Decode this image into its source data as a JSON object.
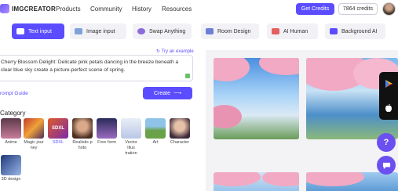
{
  "header": {
    "brand": "IMGCREATOR",
    "nav": [
      "Products",
      "Community",
      "History",
      "Resources"
    ],
    "get_credits": "Get Credits",
    "credits": "7864 credits"
  },
  "tabs": [
    {
      "label": "Text input",
      "active": true
    },
    {
      "label": "Image input"
    },
    {
      "label": "Swap Anything"
    },
    {
      "label": "Room Design"
    },
    {
      "label": "AI Human"
    },
    {
      "label": "Background AI"
    }
  ],
  "prompt": {
    "try_example": "Try an example",
    "text": "Cherry Blossom Delight: Delicate pink petals dancing in the breeze beneath a clear blue sky create a picture-perfect scene of spring.",
    "guide": "rompt Guide",
    "create": "Create"
  },
  "category": {
    "title": "Category",
    "items": [
      {
        "label": "Anime"
      },
      {
        "label": "Magic jour ney"
      },
      {
        "label": "SDXL",
        "selected": true
      },
      {
        "label": "Realistic p hoto"
      },
      {
        "label": "Free form"
      },
      {
        "label": "Vector Illus tration"
      },
      {
        "label": "Art"
      },
      {
        "label": "Character"
      },
      {
        "label": "3D design"
      }
    ]
  },
  "colors": {
    "accent": "#5b4dff",
    "float_button": "#6b4ff0"
  }
}
